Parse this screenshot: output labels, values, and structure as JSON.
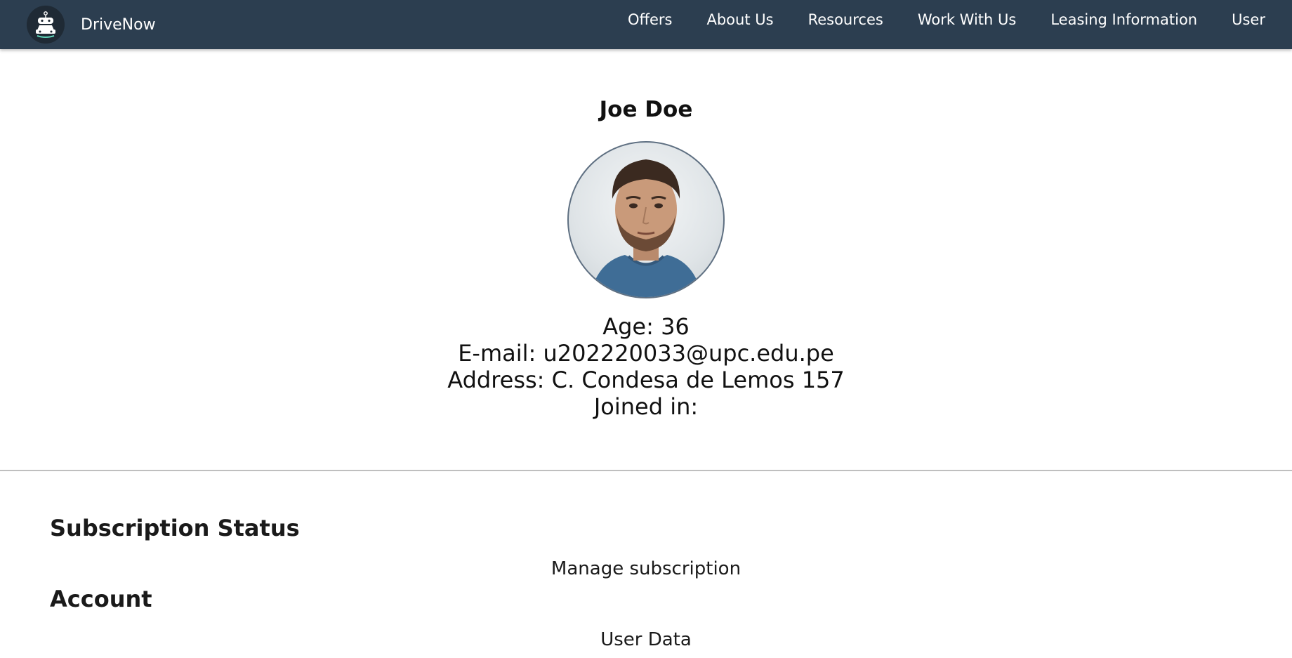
{
  "navbar": {
    "brand_name": "DriveNow",
    "links": [
      "Offers",
      "About Us",
      "Resources",
      "Work With Us",
      "Leasing Information",
      "User"
    ]
  },
  "profile": {
    "name": "Joe Doe",
    "age": "Age: 36",
    "email": "E-mail: u202220033@upc.edu.pe",
    "address": "Address: C. Condesa de Lemos 157",
    "joined": "Joined in:"
  },
  "sections": {
    "subscription_title": "Subscription Status",
    "subscription_link": "Manage subscription",
    "account_title": "Account",
    "account_link": "User Data"
  },
  "colors": {
    "navbar_bg": "#2c3e50",
    "navbar_text": "#ffffff",
    "divider": "#bfbfbf"
  },
  "icons": {
    "logo": "car-robot-logo-icon",
    "avatar": "user-avatar-photo"
  }
}
